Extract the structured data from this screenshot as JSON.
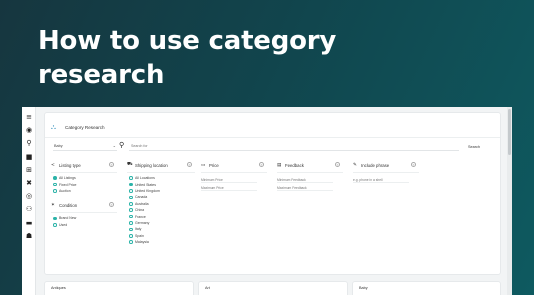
{
  "hero": {
    "title": "How to use category research"
  },
  "sidebar": {
    "items": [
      {
        "icon": "menu-icon",
        "glyph": "≡"
      },
      {
        "icon": "eye-icon",
        "glyph": "◉"
      },
      {
        "icon": "magnify-icon",
        "glyph": "⚲"
      },
      {
        "icon": "box-icon",
        "glyph": "■"
      },
      {
        "icon": "sitemap-icon",
        "glyph": "⊞"
      },
      {
        "icon": "tools-icon",
        "glyph": "✖"
      },
      {
        "icon": "target-icon",
        "glyph": "◎"
      },
      {
        "icon": "user-plus-icon",
        "glyph": "⚇"
      },
      {
        "icon": "folder-icon",
        "glyph": "▬"
      },
      {
        "icon": "user-icon",
        "glyph": "☗"
      }
    ]
  },
  "page": {
    "title": "Category Research",
    "category_value": "Baby",
    "search_placeholder": "Search for",
    "search_button": "Search"
  },
  "filters": {
    "listing_type": {
      "label": "Listing type",
      "options": [
        {
          "label": "All Listings",
          "selected": true
        },
        {
          "label": "Fixed Price",
          "selected": false
        },
        {
          "label": "Auction",
          "selected": false
        }
      ]
    },
    "condition": {
      "label": "Condition",
      "options": [
        {
          "label": "Brand New",
          "selected": true
        },
        {
          "label": "Used",
          "selected": false
        }
      ]
    },
    "shipping_location": {
      "label": "Shipping location",
      "options": [
        {
          "label": "All Locations",
          "selected": false
        },
        {
          "label": "United States",
          "selected": true
        },
        {
          "label": "United Kingdom",
          "selected": false
        },
        {
          "label": "Canada",
          "selected": false
        },
        {
          "label": "Australia",
          "selected": false
        },
        {
          "label": "China",
          "selected": false
        },
        {
          "label": "France",
          "selected": false
        },
        {
          "label": "Germany",
          "selected": false
        },
        {
          "label": "Italy",
          "selected": false
        },
        {
          "label": "Spain",
          "selected": false
        },
        {
          "label": "Malaysia",
          "selected": false
        }
      ]
    },
    "price": {
      "label": "Price",
      "min_placeholder": "Minimum Price",
      "max_placeholder": "Maximum Price"
    },
    "feedback": {
      "label": "Feedback",
      "min_placeholder": "Minimum Feedback",
      "max_placeholder": "Maximum Feedback"
    },
    "include_phrase": {
      "label": "Include phrase",
      "placeholder": "e.g. phone in a shell"
    }
  },
  "categories": [
    "Antiques",
    "Art",
    "Baby"
  ],
  "colors": {
    "accent": "#2bb3a8",
    "hero_bg": "#12474f"
  }
}
